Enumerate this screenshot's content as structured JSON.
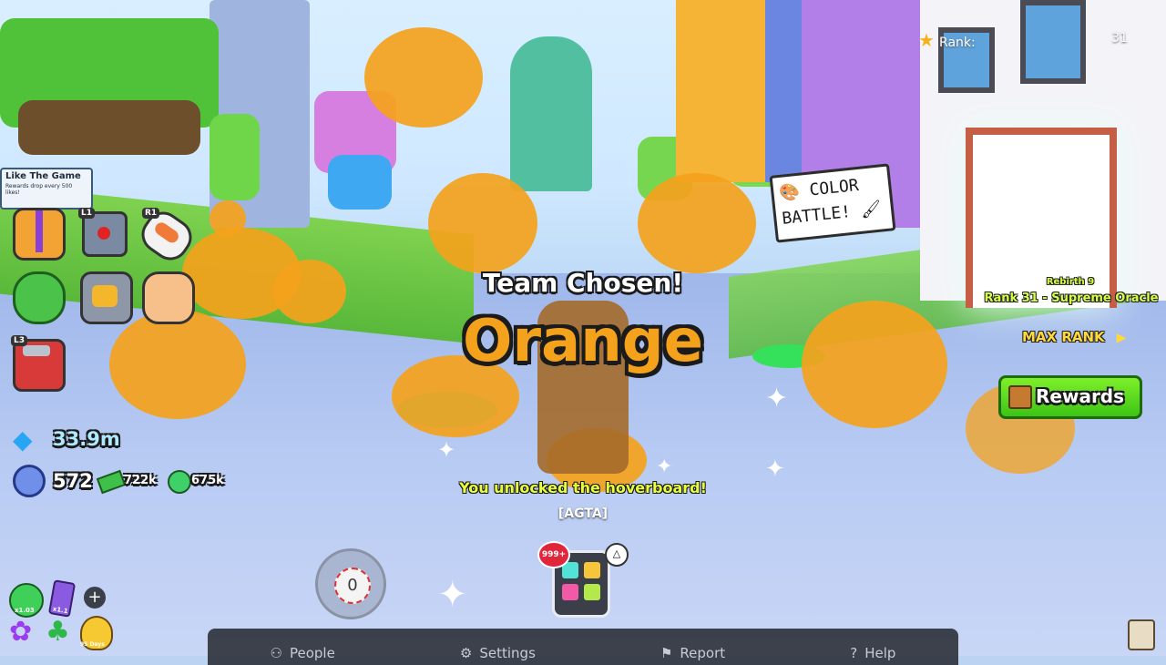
{
  "world": {
    "sign_text_line1": "COLOR",
    "sign_text_line2": "BATTLE!",
    "like_board_title": "Like The Game",
    "like_board_sub": "Rewards drop every 500 likes!"
  },
  "announcement": {
    "subtitle": "Team Chosen!",
    "team": "Orange",
    "team_color": "#f4a21c",
    "unlock_message": "You unlocked the hoverboard!",
    "player_tag": "[AGTA]"
  },
  "rank_panel": {
    "rank_label": "Rank:",
    "rank_value": "31",
    "rebirth": "Rebirth 9",
    "rank_title": "Rank 31 - Supreme Oracle",
    "max_rank": "MAX RANK",
    "rewards_button": "Rewards"
  },
  "left_menu": {
    "badges": {
      "l1": "L1",
      "r1": "R1",
      "l3": "L3"
    }
  },
  "currency": {
    "diamonds": "33.9m",
    "gems": "572",
    "green_1": "722k",
    "green_2": "675k"
  },
  "boosts": {
    "boost1": "x1.03",
    "boost2": "x1.1",
    "boost3": "95 Days",
    "add": "+"
  },
  "hotbar": {
    "counter": "0",
    "inventory_badge": "999+"
  },
  "bottom_bar": {
    "people": "People",
    "settings": "Settings",
    "report": "Report",
    "help": "Help"
  },
  "colors": {
    "accent_orange": "#f4a21c",
    "rank_green": "#b7f542",
    "rewards_green": "#55d61b"
  }
}
